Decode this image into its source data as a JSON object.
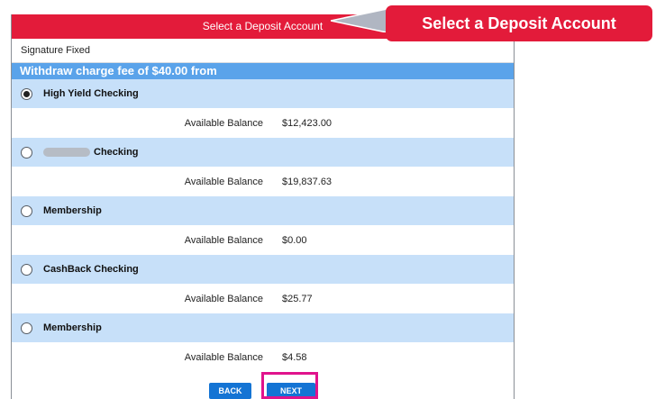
{
  "header": {
    "title": "Select a Deposit Account"
  },
  "subtitle": "Signature Fixed",
  "section_title": "Withdraw charge fee of $40.00 from",
  "balance_label": "Available Balance",
  "accounts": [
    {
      "name": "High Yield Checking",
      "balance": "$12,423.00",
      "selected": true
    },
    {
      "name": "Checking",
      "balance": "$19,837.63",
      "selected": false,
      "name_partially_redacted": true
    },
    {
      "name": "Membership",
      "balance": "$0.00",
      "selected": false
    },
    {
      "name": "CashBack Checking",
      "balance": "$25.77",
      "selected": false
    },
    {
      "name": "Membership",
      "balance": "$4.58",
      "selected": false
    }
  ],
  "buttons": {
    "back": "BACK",
    "next": "NEXT"
  },
  "callout": {
    "text": "Select a Deposit Account"
  },
  "colors": {
    "header_red": "#e31b3a",
    "section_blue": "#5aa3ea",
    "row_blue": "#c7e0f9",
    "button_blue": "#1474d4",
    "highlight_magenta": "#e0138c"
  }
}
